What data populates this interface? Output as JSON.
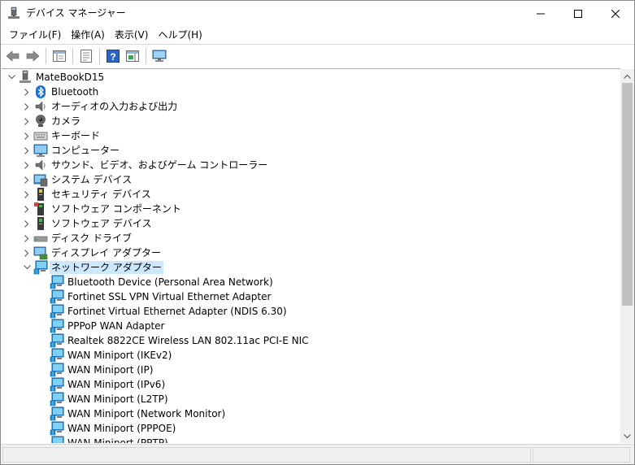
{
  "window": {
    "title": "デバイス マネージャー",
    "controls": {
      "minimize": "minimize",
      "maximize": "maximize",
      "close": "close"
    }
  },
  "menu": [
    {
      "label": "ファイル(F)"
    },
    {
      "label": "操作(A)"
    },
    {
      "label": "表示(V)"
    },
    {
      "label": "ヘルプ(H)"
    }
  ],
  "toolbar": {
    "buttons": [
      "back-arrow-icon",
      "forward-arrow-icon",
      "properties-icon",
      "update-driver-icon",
      "help-icon",
      "action-view-icon",
      "monitor-icon"
    ]
  },
  "tree": {
    "root": {
      "label": "MateBookD15",
      "icon": "computer-tower-icon",
      "expanded": true
    },
    "categories": [
      {
        "label": "Bluetooth",
        "icon": "bluetooth-icon",
        "expanded": false
      },
      {
        "label": "オーディオの入力および出力",
        "icon": "speaker-icon",
        "expanded": false
      },
      {
        "label": "カメラ",
        "icon": "camera-icon",
        "expanded": false
      },
      {
        "label": "キーボード",
        "icon": "keyboard-icon",
        "expanded": false
      },
      {
        "label": "コンピューター",
        "icon": "monitor-icon",
        "expanded": false
      },
      {
        "label": "サウンド、ビデオ、およびゲーム コントローラー",
        "icon": "speaker-icon",
        "expanded": false
      },
      {
        "label": "システム デバイス",
        "icon": "system-device-icon",
        "expanded": false
      },
      {
        "label": "セキュリティ デバイス",
        "icon": "security-device-icon",
        "expanded": false
      },
      {
        "label": "ソフトウェア コンポーネント",
        "icon": "software-component-icon",
        "expanded": false
      },
      {
        "label": "ソフトウェア デバイス",
        "icon": "software-device-icon",
        "expanded": false
      },
      {
        "label": "ディスク ドライブ",
        "icon": "disk-drive-icon",
        "expanded": false
      },
      {
        "label": "ディスプレイ アダプター",
        "icon": "display-adapter-icon",
        "expanded": false
      },
      {
        "label": "ネットワーク アダプター",
        "icon": "network-adapter-icon",
        "expanded": true,
        "selected": true
      }
    ],
    "network_adapters": [
      "Bluetooth Device (Personal Area Network)",
      "Fortinet SSL VPN Virtual Ethernet Adapter",
      "Fortinet Virtual Ethernet Adapter (NDIS 6.30)",
      "PPPoP WAN Adapter",
      "Realtek 8822CE Wireless LAN 802.11ac PCI-E NIC",
      "WAN Miniport (IKEv2)",
      "WAN Miniport (IP)",
      "WAN Miniport (IPv6)",
      "WAN Miniport (L2TP)",
      "WAN Miniport (Network Monitor)",
      "WAN Miniport (PPPOE)",
      "WAN Miniport (PPTP)"
    ]
  },
  "colors": {
    "selection": "#cce8ff",
    "network_icon": "#1f8fd6",
    "status_bar": "#f0f0f0"
  }
}
